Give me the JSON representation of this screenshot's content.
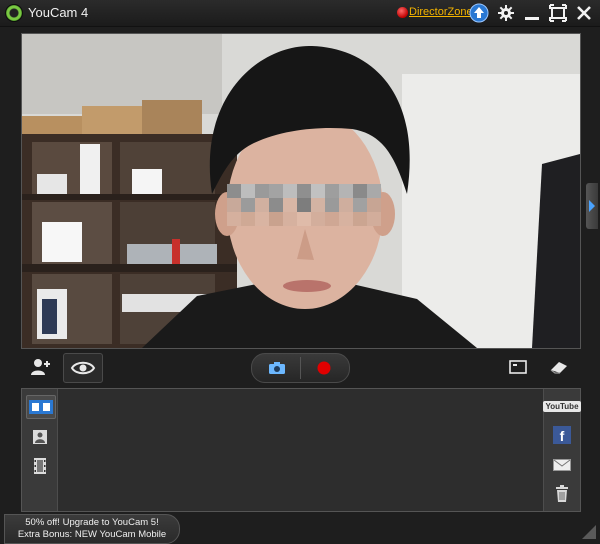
{
  "app": {
    "title": "YouCam 4",
    "director_zone_label": "DirectorZone"
  },
  "icons": {
    "upload": "upload-arrow-icon",
    "settings": "gear-icon",
    "minimize": "minimize-icon",
    "maximize": "maximize-icon",
    "close": "close-icon"
  },
  "toolbar": {
    "face_login": "face-login-icon",
    "eye_effect": "eye-icon",
    "snapshot": "camera-icon",
    "record": "record-icon",
    "fullscreen": "screen-icon",
    "eraser": "eraser-icon"
  },
  "rail_left": [
    "gallery-view-icon",
    "person-icon",
    "film-strip-icon"
  ],
  "rail_right": {
    "youtube_label": "YouTube",
    "facebook_label": "f",
    "email": "envelope-icon",
    "delete": "trash-icon"
  },
  "promo": {
    "line1": "50% off! Upgrade to YouCam 5!",
    "line2": "Extra Bonus: NEW YouCam Mobile"
  },
  "colors": {
    "accent_blue": "#2a78d2",
    "record_red": "#e00000",
    "link_orange": "#f4b400"
  }
}
